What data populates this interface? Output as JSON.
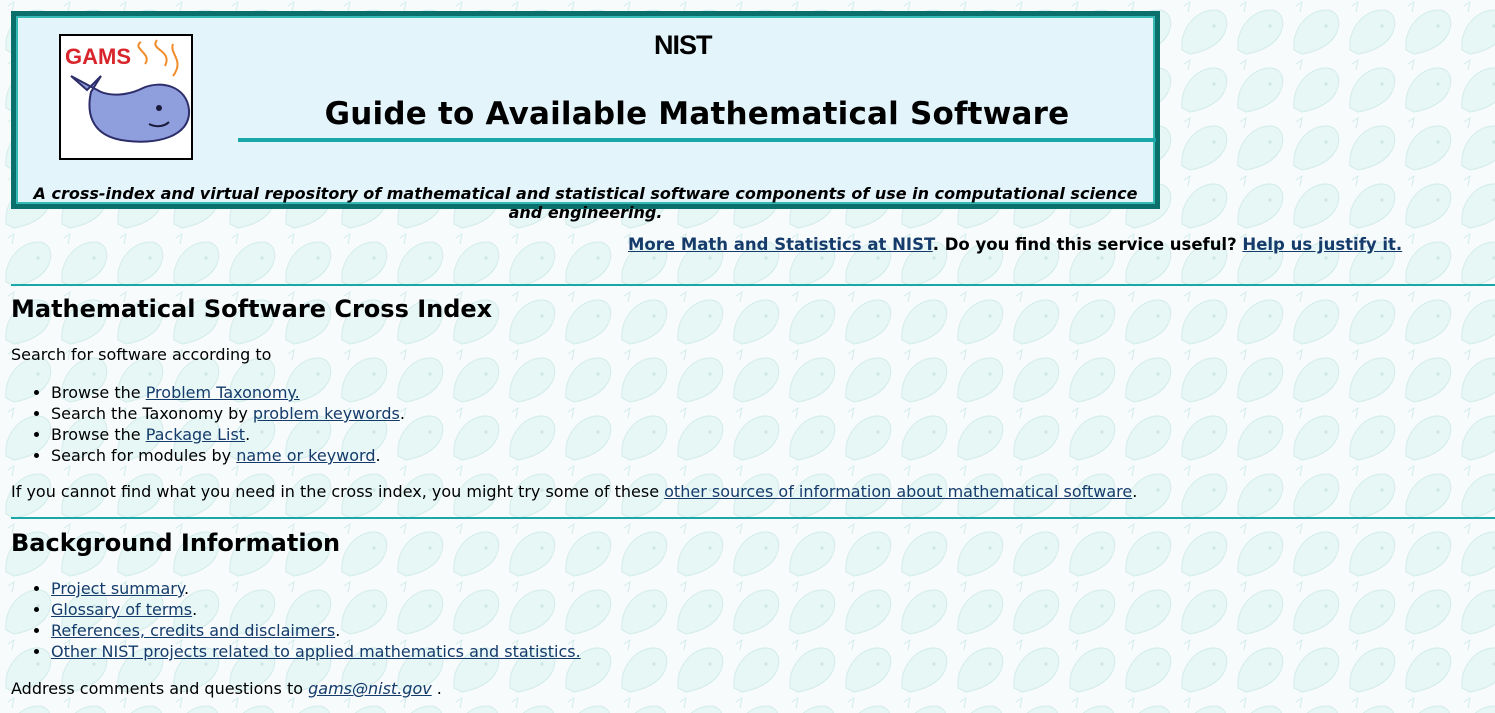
{
  "header": {
    "logo_text": "GAMS",
    "org_logo_text": "NIST",
    "title": "Guide to Available Mathematical Software",
    "tagline": "A cross-index and virtual repository of mathematical and statistical software components of use in computational science and engineering."
  },
  "top_links": {
    "more_math": "More Math and Statistics at NIST",
    "question": " Do you find this service useful? ",
    "help": "Help us justify it.",
    "period": "."
  },
  "cross_index": {
    "heading": "Mathematical Software Cross Index",
    "intro": "Search for software according to",
    "items": [
      {
        "prefix": "Browse the ",
        "link": "Problem Taxonomy.",
        "suffix": ""
      },
      {
        "prefix": "Search the Taxonomy by ",
        "link": "problem keywords",
        "suffix": "."
      },
      {
        "prefix": "Browse the ",
        "link": "Package List",
        "suffix": "."
      },
      {
        "prefix": "Search for modules by ",
        "link": "name or keyword",
        "suffix": "."
      }
    ],
    "other_prefix": "If you cannot find what you need in the cross index, you might try some of these ",
    "other_link": "other sources of information about mathematical software",
    "other_suffix": "."
  },
  "background": {
    "heading": "Background Information",
    "items": [
      {
        "link": "Project summary",
        "suffix": "."
      },
      {
        "link": "Glossary of terms",
        "suffix": "."
      },
      {
        "link": "References, credits and disclaimers",
        "suffix": "."
      },
      {
        "link": "Other NIST projects related to applied mathematics and statistics.",
        "suffix": ""
      }
    ],
    "address_prefix": "Address comments and questions to ",
    "address_email": "gams@nist.gov",
    "address_suffix": " ."
  },
  "colors": {
    "accent": "#1aa7a7",
    "header_border": "#0b6f6c",
    "header_bg": "#e3f4fb",
    "link": "#153b6b"
  }
}
